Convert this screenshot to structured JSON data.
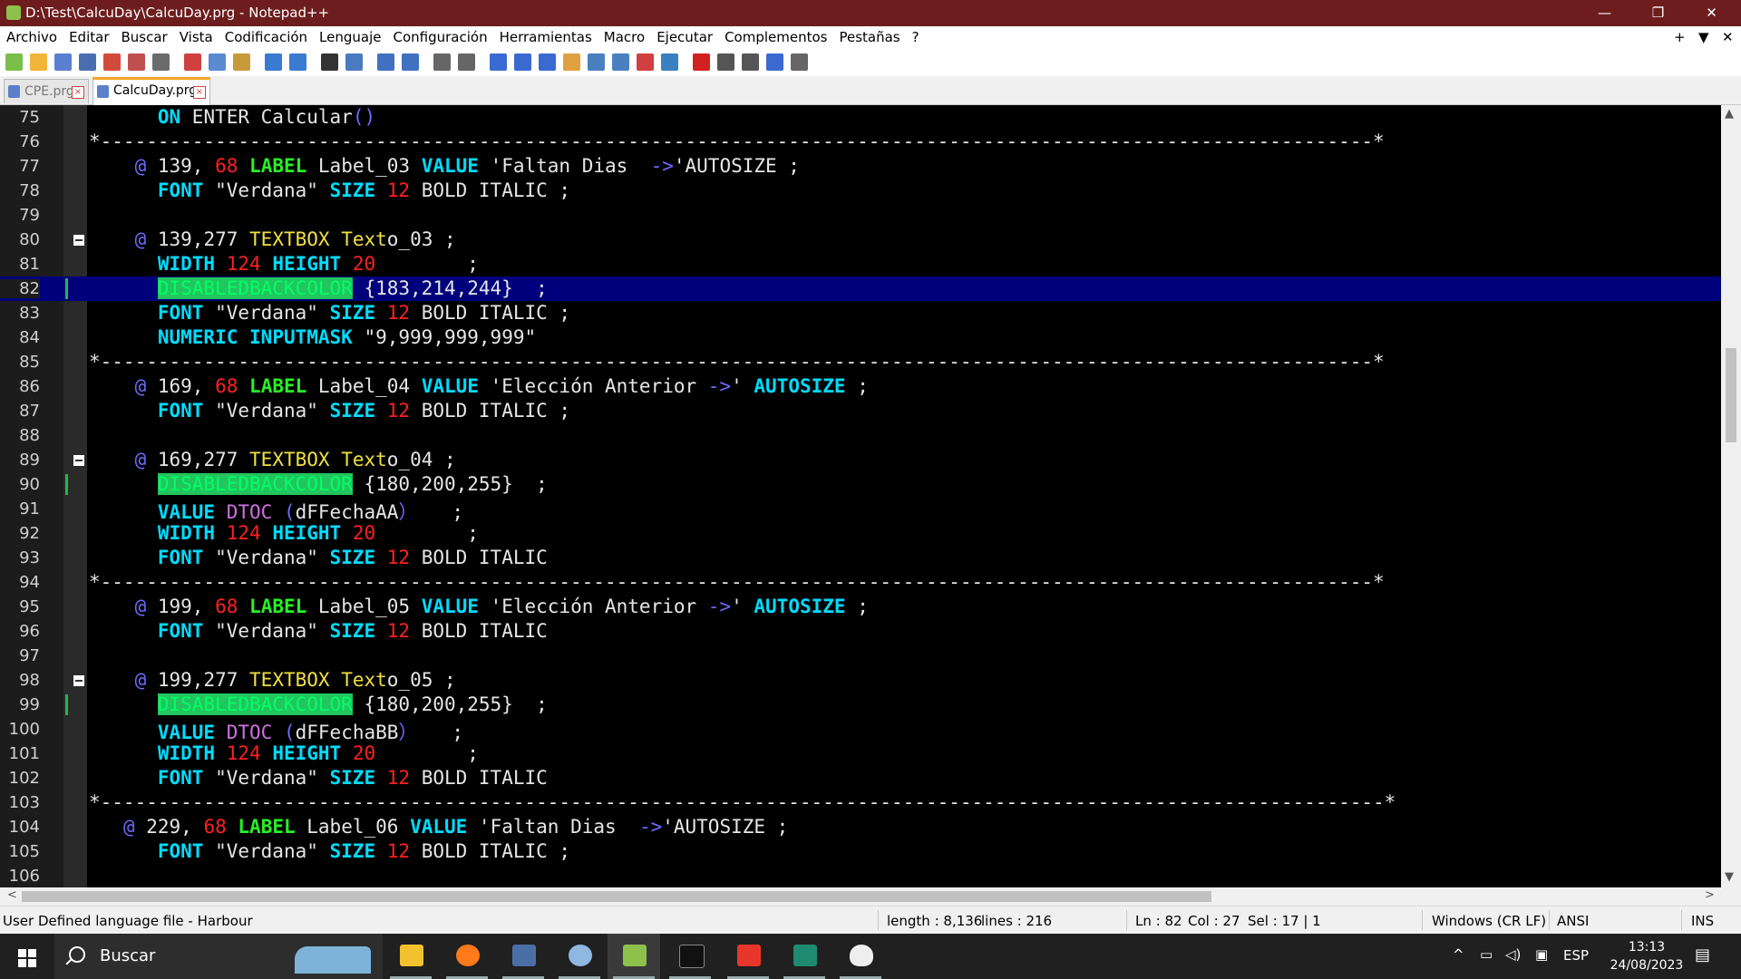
{
  "window": {
    "title": "D:\\Test\\CalcuDay\\CalcuDay.prg - Notepad++",
    "minimize": "—",
    "restore": "❐",
    "close": "✕"
  },
  "menu": {
    "items": [
      "Archivo",
      "Editar",
      "Buscar",
      "Vista",
      "Codificación",
      "Lenguaje",
      "Configuración",
      "Herramientas",
      "Macro",
      "Ejecutar",
      "Complementos",
      "Pestañas",
      "?"
    ],
    "right": [
      "+",
      "▼",
      "✕"
    ]
  },
  "toolbar": {
    "icons": [
      "new-file",
      "open-file",
      "save",
      "save-all",
      "close",
      "close-all",
      "print",
      "cut",
      "copy",
      "paste",
      "undo",
      "redo",
      "find",
      "replace",
      "zoom-in",
      "zoom-out",
      "sync-vertical",
      "sync-horizontal",
      "word-wrap",
      "show-all-chars",
      "indent-guide",
      "udl",
      "doc-map",
      "function-list",
      "folder-workspace",
      "monitor",
      "record-macro",
      "stop-macro",
      "play-macro",
      "run-macro-multiple",
      "save-macro"
    ]
  },
  "tabs": [
    {
      "label": "CPE.prg",
      "active": false
    },
    {
      "label": "CalcuDay.prg",
      "active": true
    }
  ],
  "editor": {
    "current_line": 82,
    "lines": [
      {
        "n": "75",
        "tokens": [
          [
            "s",
            "      "
          ],
          [
            "k",
            "ON"
          ],
          [
            "s",
            " ENTER Calcular"
          ],
          [
            "o",
            "()"
          ]
        ]
      },
      {
        "n": "76",
        "tokens": [
          [
            "s",
            "*---------------------------------------------------------------------------------------------------------------*"
          ]
        ]
      },
      {
        "n": "77",
        "tokens": [
          [
            "s",
            "    "
          ],
          [
            "o",
            "@"
          ],
          [
            "s",
            " 139, "
          ],
          [
            "n",
            "68"
          ],
          [
            "s",
            " "
          ],
          [
            "g",
            "LABEL"
          ],
          [
            "s",
            " Label_03 "
          ],
          [
            "k",
            "VALUE"
          ],
          [
            "s",
            " 'Faltan Dias  "
          ],
          [
            "o",
            "->"
          ],
          [
            "s",
            "'AUTOSIZE ;"
          ]
        ]
      },
      {
        "n": "78",
        "tokens": [
          [
            "s",
            "      "
          ],
          [
            "k",
            "FONT"
          ],
          [
            "s",
            " \"Verdana\" "
          ],
          [
            "k",
            "SIZE"
          ],
          [
            "s",
            " "
          ],
          [
            "n",
            "12"
          ],
          [
            "s",
            " BOLD ITALIC ;"
          ]
        ]
      },
      {
        "n": "79",
        "tokens": [
          [
            "s",
            ""
          ]
        ]
      },
      {
        "n": "80",
        "fold": true,
        "tokens": [
          [
            "s",
            "    "
          ],
          [
            "o",
            "@"
          ],
          [
            "s",
            " 139,277 "
          ],
          [
            "y",
            "TEXTBOX"
          ],
          [
            "s",
            " "
          ],
          [
            "y",
            "Text"
          ],
          [
            "s",
            "o_03 ;"
          ]
        ]
      },
      {
        "n": "81",
        "tokens": [
          [
            "s",
            "      "
          ],
          [
            "k",
            "WIDTH"
          ],
          [
            "s",
            " "
          ],
          [
            "n",
            "124"
          ],
          [
            "s",
            " "
          ],
          [
            "k",
            "HEIGHT"
          ],
          [
            "s",
            " "
          ],
          [
            "n",
            "20"
          ],
          [
            "s",
            "        ;"
          ]
        ]
      },
      {
        "n": "82",
        "change": true,
        "tokens": [
          [
            "s",
            "      "
          ],
          [
            "hl",
            "DISABLEDBACKCOLOR"
          ],
          [
            "s",
            " {183,214,244}  ;"
          ]
        ]
      },
      {
        "n": "83",
        "tokens": [
          [
            "s",
            "      "
          ],
          [
            "k",
            "FONT"
          ],
          [
            "s",
            " \"Verdana\" "
          ],
          [
            "k",
            "SIZE"
          ],
          [
            "s",
            " "
          ],
          [
            "n",
            "12"
          ],
          [
            "s",
            " BOLD ITALIC ;"
          ]
        ]
      },
      {
        "n": "84",
        "tokens": [
          [
            "s",
            "      "
          ],
          [
            "k",
            "NUMERIC"
          ],
          [
            "s",
            " "
          ],
          [
            "k",
            "INPUTMASK"
          ],
          [
            "s",
            " \"9,999,999,999\""
          ]
        ]
      },
      {
        "n": "85",
        "tokens": [
          [
            "s",
            "*---------------------------------------------------------------------------------------------------------------*"
          ]
        ]
      },
      {
        "n": "86",
        "tokens": [
          [
            "s",
            "    "
          ],
          [
            "o",
            "@"
          ],
          [
            "s",
            " 169, "
          ],
          [
            "n",
            "68"
          ],
          [
            "s",
            " "
          ],
          [
            "g",
            "LABEL"
          ],
          [
            "s",
            " Label_04 "
          ],
          [
            "k",
            "VALUE"
          ],
          [
            "s",
            " 'Elección Anterior "
          ],
          [
            "o",
            "->"
          ],
          [
            "s",
            "' "
          ],
          [
            "k",
            "AUTOSIZE"
          ],
          [
            "s",
            " ;"
          ]
        ]
      },
      {
        "n": "87",
        "tokens": [
          [
            "s",
            "      "
          ],
          [
            "k",
            "FONT"
          ],
          [
            "s",
            " \"Verdana\" "
          ],
          [
            "k",
            "SIZE"
          ],
          [
            "s",
            " "
          ],
          [
            "n",
            "12"
          ],
          [
            "s",
            " BOLD ITALIC ;"
          ]
        ]
      },
      {
        "n": "88",
        "tokens": [
          [
            "s",
            ""
          ]
        ]
      },
      {
        "n": "89",
        "fold": true,
        "tokens": [
          [
            "s",
            "    "
          ],
          [
            "o",
            "@"
          ],
          [
            "s",
            " 169,277 "
          ],
          [
            "y",
            "TEXTBOX"
          ],
          [
            "s",
            " "
          ],
          [
            "y",
            "Text"
          ],
          [
            "s",
            "o_04 ;"
          ]
        ]
      },
      {
        "n": "90",
        "change": true,
        "tokens": [
          [
            "s",
            "      "
          ],
          [
            "hl",
            "DISABLEDBACKCOLOR"
          ],
          [
            "s",
            " {180,200,255}  ;"
          ]
        ]
      },
      {
        "n": "91",
        "tokens": [
          [
            "s",
            "      "
          ],
          [
            "k",
            "VALUE"
          ],
          [
            "s",
            " "
          ],
          [
            "m",
            "DTOC"
          ],
          [
            "s",
            " "
          ],
          [
            "o",
            "("
          ],
          [
            "s",
            "dFFechaAA"
          ],
          [
            "o",
            "）"
          ],
          [
            "s",
            "   ;"
          ]
        ]
      },
      {
        "n": "92",
        "tokens": [
          [
            "s",
            "      "
          ],
          [
            "k",
            "WIDTH"
          ],
          [
            "s",
            " "
          ],
          [
            "n",
            "124"
          ],
          [
            "s",
            " "
          ],
          [
            "k",
            "HEIGHT"
          ],
          [
            "s",
            " "
          ],
          [
            "n",
            "20"
          ],
          [
            "s",
            "        ;"
          ]
        ]
      },
      {
        "n": "93",
        "tokens": [
          [
            "s",
            "      "
          ],
          [
            "k",
            "FONT"
          ],
          [
            "s",
            " \"Verdana\" "
          ],
          [
            "k",
            "SIZE"
          ],
          [
            "s",
            " "
          ],
          [
            "n",
            "12"
          ],
          [
            "s",
            " BOLD ITALIC"
          ]
        ]
      },
      {
        "n": "94",
        "tokens": [
          [
            "s",
            "*---------------------------------------------------------------------------------------------------------------*"
          ]
        ]
      },
      {
        "n": "95",
        "tokens": [
          [
            "s",
            "    "
          ],
          [
            "o",
            "@"
          ],
          [
            "s",
            " 199, "
          ],
          [
            "n",
            "68"
          ],
          [
            "s",
            " "
          ],
          [
            "g",
            "LABEL"
          ],
          [
            "s",
            " Label_05 "
          ],
          [
            "k",
            "VALUE"
          ],
          [
            "s",
            " 'Elección Anterior "
          ],
          [
            "o",
            "->"
          ],
          [
            "s",
            "' "
          ],
          [
            "k",
            "AUTOSIZE"
          ],
          [
            "s",
            " ;"
          ]
        ]
      },
      {
        "n": "96",
        "tokens": [
          [
            "s",
            "      "
          ],
          [
            "k",
            "FONT"
          ],
          [
            "s",
            " \"Verdana\" "
          ],
          [
            "k",
            "SIZE"
          ],
          [
            "s",
            " "
          ],
          [
            "n",
            "12"
          ],
          [
            "s",
            " BOLD ITALIC"
          ]
        ]
      },
      {
        "n": "97",
        "tokens": [
          [
            "s",
            ""
          ]
        ]
      },
      {
        "n": "98",
        "fold": true,
        "tokens": [
          [
            "s",
            "    "
          ],
          [
            "o",
            "@"
          ],
          [
            "s",
            " 199,277 "
          ],
          [
            "y",
            "TEXTBOX"
          ],
          [
            "s",
            " "
          ],
          [
            "y",
            "Text"
          ],
          [
            "s",
            "o_05 ;"
          ]
        ]
      },
      {
        "n": "99",
        "change": true,
        "tokens": [
          [
            "s",
            "      "
          ],
          [
            "hl",
            "DISABLEDBACKCOLOR"
          ],
          [
            "s",
            " {180,200,255}  ;"
          ]
        ]
      },
      {
        "n": "100",
        "tokens": [
          [
            "s",
            "      "
          ],
          [
            "k",
            "VALUE"
          ],
          [
            "s",
            " "
          ],
          [
            "m",
            "DTOC"
          ],
          [
            "s",
            " "
          ],
          [
            "o",
            "("
          ],
          [
            "s",
            "dFFechaBB"
          ],
          [
            "o",
            "）"
          ],
          [
            "s",
            "   ;"
          ]
        ]
      },
      {
        "n": "101",
        "tokens": [
          [
            "s",
            "      "
          ],
          [
            "k",
            "WIDTH"
          ],
          [
            "s",
            " "
          ],
          [
            "n",
            "124"
          ],
          [
            "s",
            " "
          ],
          [
            "k",
            "HEIGHT"
          ],
          [
            "s",
            " "
          ],
          [
            "n",
            "20"
          ],
          [
            "s",
            "        ;"
          ]
        ]
      },
      {
        "n": "102",
        "tokens": [
          [
            "s",
            "      "
          ],
          [
            "k",
            "FONT"
          ],
          [
            "s",
            " \"Verdana\" "
          ],
          [
            "k",
            "SIZE"
          ],
          [
            "s",
            " "
          ],
          [
            "n",
            "12"
          ],
          [
            "s",
            " BOLD ITALIC"
          ]
        ]
      },
      {
        "n": "103",
        "tokens": [
          [
            "s",
            "*----------------------------------------------------------------------------------------------------------------*"
          ]
        ]
      },
      {
        "n": "104",
        "tokens": [
          [
            "s",
            "   "
          ],
          [
            "o",
            "@"
          ],
          [
            "s",
            " 229, "
          ],
          [
            "n",
            "68"
          ],
          [
            "s",
            " "
          ],
          [
            "g",
            "LABEL"
          ],
          [
            "s",
            " Label_06 "
          ],
          [
            "k",
            "VALUE"
          ],
          [
            "s",
            " 'Faltan Dias  "
          ],
          [
            "o",
            "->"
          ],
          [
            "s",
            "'AUTOSIZE ;"
          ]
        ]
      },
      {
        "n": "105",
        "tokens": [
          [
            "s",
            "      "
          ],
          [
            "k",
            "FONT"
          ],
          [
            "s",
            " \"Verdana\" "
          ],
          [
            "k",
            "SIZE"
          ],
          [
            "s",
            " "
          ],
          [
            "n",
            "12"
          ],
          [
            "s",
            " BOLD ITALIC ;"
          ]
        ]
      },
      {
        "n": "106",
        "tokens": [
          [
            "s",
            ""
          ]
        ]
      }
    ]
  },
  "scroll": {
    "up": "▲",
    "down": "▼",
    "left": "<",
    "right": ">"
  },
  "status": {
    "lang": "User Defined language file - Harbour",
    "length": "length : 8,136",
    "lines": "lines : 216",
    "ln": "Ln : 82",
    "col": "Col : 27",
    "sel": "Sel : 17 | 1",
    "eol": "Windows (CR LF)",
    "encoding": "ANSI",
    "mode": "INS"
  },
  "taskbar": {
    "search_label": "Buscar",
    "apps": [
      "file-explorer",
      "firefox",
      "calculator",
      "marble",
      "notepad-plus-plus",
      "terminal",
      "anydesk",
      "app-window",
      "linux-tux"
    ],
    "tray_lang": "ESP",
    "time": "13:13",
    "date": "24/08/2023"
  },
  "colors": {
    "title_bar": "#6d1d1d",
    "editor_bg": "#000000",
    "current_line": "#00007c",
    "keyword": "#00dcff",
    "label_kw": "#28f028",
    "number": "#ff2020",
    "textbox_kw": "#f0e040"
  }
}
